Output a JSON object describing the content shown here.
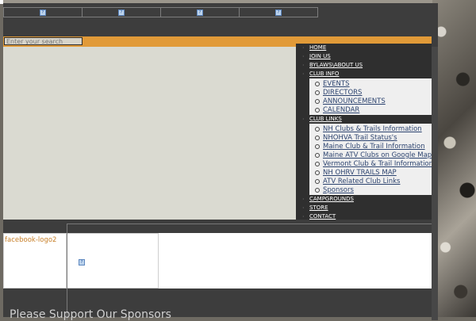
{
  "search": {
    "placeholder": "Enter your search"
  },
  "topnav": {
    "tab_count": 4
  },
  "menu": {
    "items": [
      {
        "label": "HOME"
      },
      {
        "label": "JOIN US"
      },
      {
        "label": "BYLAWS\\ABOUT US"
      },
      {
        "label": "CLUB INFO",
        "children": [
          "EVENTS",
          "DIRECTORS",
          "ANNOUNCEMENTS",
          "CALENDAR"
        ]
      },
      {
        "label": "CLUB LINKS",
        "children": [
          "NH Clubs & Trails Information",
          "NHOHVA Trail Status's",
          "Maine Club & Trail Information",
          "Maine ATV Clubs on Google Maps",
          "Vermont Club & Trail Information",
          "NH OHRV TRAILS MAP",
          "ATV Related Club Links",
          "Sponsors"
        ]
      },
      {
        "label": "CAMPGROUNDS"
      },
      {
        "label": "STORE"
      },
      {
        "label": "CONTACT"
      }
    ]
  },
  "facebook": {
    "alt_text": "facebook-logo2"
  },
  "sponsors_heading": "Please Support Our Sponsors",
  "colors": {
    "accent": "#e19a38",
    "nav_bg": "#3d3d3d",
    "hero_bg": "#dadad1"
  }
}
